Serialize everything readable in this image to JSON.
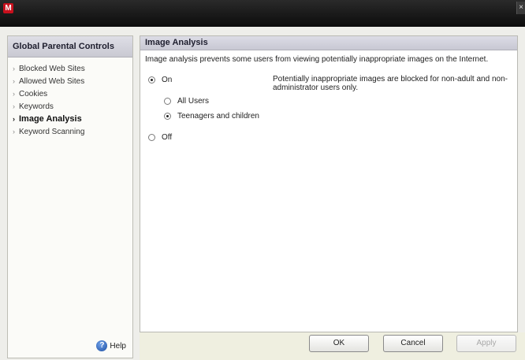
{
  "window": {
    "app_icon_letter": "M",
    "close_glyph": "×"
  },
  "sidebar": {
    "title": "Global Parental Controls",
    "items": [
      {
        "label": "Blocked Web Sites",
        "active": false
      },
      {
        "label": "Allowed Web Sites",
        "active": false
      },
      {
        "label": "Cookies",
        "active": false
      },
      {
        "label": "Keywords",
        "active": false
      },
      {
        "label": "Image Analysis",
        "active": true
      },
      {
        "label": "Keyword Scanning",
        "active": false
      }
    ],
    "help_label": "Help",
    "help_icon_glyph": "?"
  },
  "panel": {
    "title": "Image Analysis",
    "description": "Image analysis prevents some users from viewing potentially inappropriate images on the Internet.",
    "options": {
      "on_label": "On",
      "on_checked": true,
      "all_users_label": "All Users",
      "all_users_checked": false,
      "teenagers_label": "Teenagers and children",
      "teenagers_checked": true,
      "off_label": "Off",
      "off_checked": false
    },
    "note": "Potentially inappropriate images are blocked for non-adult and non-administrator users only."
  },
  "buttons": {
    "ok": "OK",
    "cancel": "Cancel",
    "apply": "Apply"
  },
  "icons": {
    "chevron": "chevron-right-icon",
    "help": "help-icon",
    "app": "mcafee-logo-icon"
  },
  "colors": {
    "accent_red": "#c8101d",
    "header_bg": "#c9c9d2"
  }
}
